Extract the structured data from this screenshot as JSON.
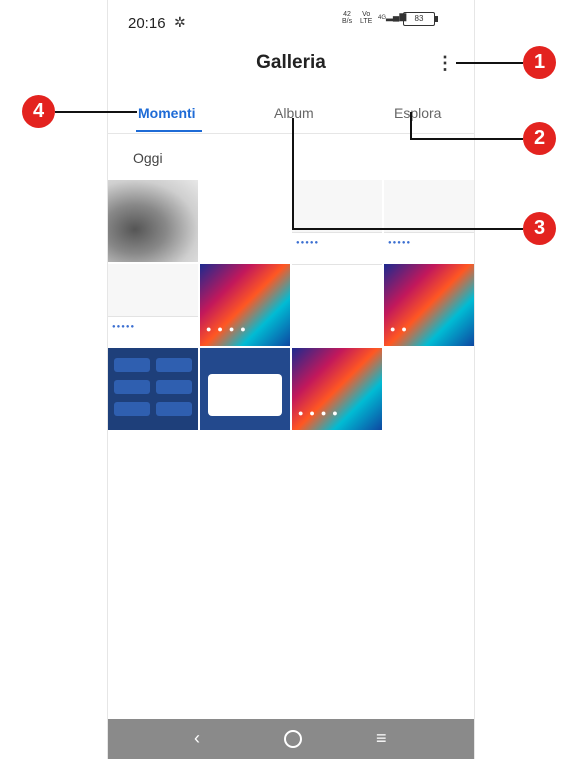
{
  "status_bar": {
    "time": "20:16",
    "net_speed": "42",
    "net_unit": "B/s",
    "volte_top": "Vo",
    "volte_bottom": "LTE",
    "signal_label": "4G",
    "battery": "83"
  },
  "app_bar": {
    "title": "Galleria"
  },
  "tabs": [
    {
      "label": "Momenti",
      "active": true
    },
    {
      "label": "Album",
      "active": false
    },
    {
      "label": "Esplora",
      "active": false
    }
  ],
  "section_label": "Oggi",
  "nav_icons": [
    "back-icon",
    "home-icon",
    "recents-icon"
  ],
  "callouts": [
    "1",
    "2",
    "3",
    "4"
  ],
  "colors": {
    "accent": "#1e6bd6",
    "callout": "#e3231f",
    "navbar": "#8a8a8a"
  }
}
